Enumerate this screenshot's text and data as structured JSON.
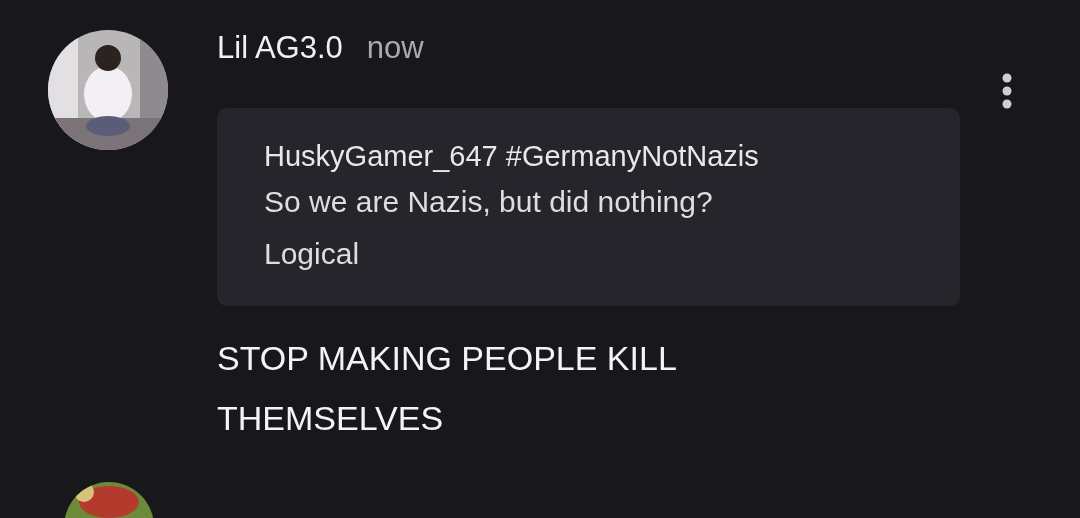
{
  "comment": {
    "author": "Lil AG3.0",
    "time": "now",
    "quote": {
      "author": "HuskyGamer_647 #GermanyNotNazis",
      "lines": [
        "So we are Nazis, but did nothing?",
        "Logical"
      ]
    },
    "lines": [
      "STOP MAKING PEOPLE KILL",
      "THEMSELVES"
    ]
  }
}
